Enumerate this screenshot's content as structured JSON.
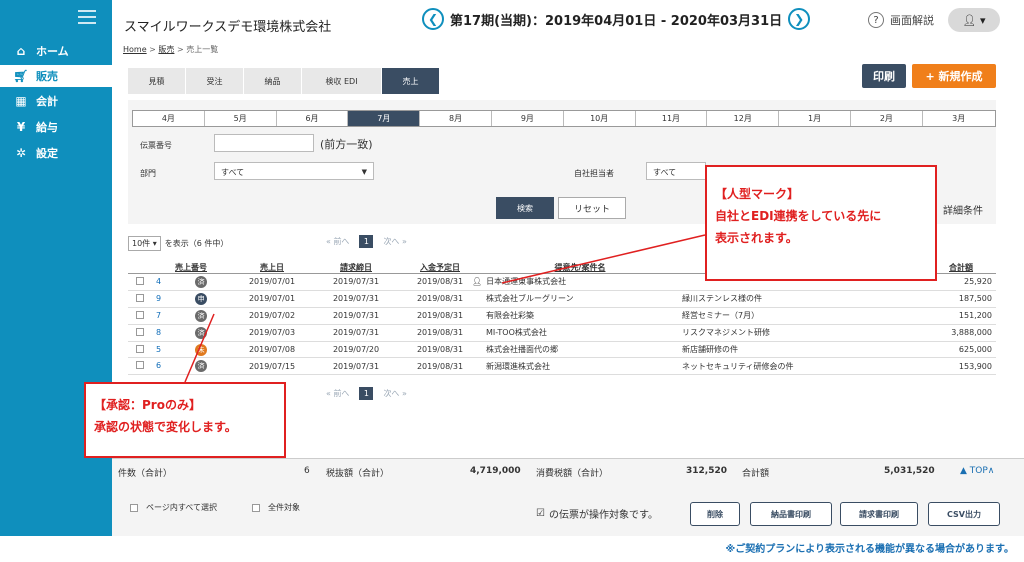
{
  "sidebar": {
    "items": [
      {
        "icon": "home-icon",
        "label": "ホーム"
      },
      {
        "icon": "cart-icon",
        "label": "販売"
      },
      {
        "icon": "calculator-icon",
        "label": "会計"
      },
      {
        "icon": "yen-bag-icon",
        "label": "給与"
      },
      {
        "icon": "gear-icon",
        "label": "設定"
      }
    ]
  },
  "header": {
    "company": "スマイルワークスデモ環境株式会社",
    "period": "第17期(当期)：2019年04月01日 - 2020年03月31日",
    "help": "画面解説"
  },
  "breadcrumb": {
    "home": "Home",
    "sales": "販売",
    "current": "売上一覧",
    "sep": ">"
  },
  "tabs": [
    "見積",
    "受注",
    "納品",
    "検収 EDI",
    "売上"
  ],
  "actions": {
    "print": "印刷",
    "new": "+ 新規作成"
  },
  "months": [
    "4月",
    "5月",
    "6月",
    "7月",
    "8月",
    "9月",
    "10月",
    "11月",
    "12月",
    "1月",
    "2月",
    "3月"
  ],
  "filters": {
    "slip_label": "伝票番号",
    "slip_hint": "(前方一致)",
    "dept_label": "部門",
    "dept_value": "すべて",
    "owner_label": "自社担当者",
    "owner_value": "すべて",
    "search": "検索",
    "reset": "リセット",
    "detail": "詳細条件"
  },
  "list": {
    "per_page": "10件",
    "showing": "を表示（6 件中）",
    "prev": "« 前へ",
    "page": "1",
    "next": "次へ »"
  },
  "columns": {
    "no": "売上番号",
    "date": "売上日",
    "bill": "請求締日",
    "due": "入金予定日",
    "customer": "得意先/案件名",
    "total": "合計額"
  },
  "rows": [
    {
      "no": "4",
      "status": "済",
      "color": "#6b6b6b",
      "date": "2019/07/01",
      "bill": "2019/07/31",
      "due": "2019/08/31",
      "customer": "日本通運東事株式会社",
      "project": "",
      "total": "25,920"
    },
    {
      "no": "9",
      "status": "申",
      "color": "#3a4d63",
      "date": "2019/07/01",
      "bill": "2019/07/31",
      "due": "2019/08/31",
      "customer": "株式会社ブルーグリーン",
      "project": "緑川ステンレス様の件",
      "total": "187,500"
    },
    {
      "no": "7",
      "status": "済",
      "color": "#6b6b6b",
      "date": "2019/07/02",
      "bill": "2019/07/31",
      "due": "2019/08/31",
      "customer": "有限会社彩築",
      "project": "経営セミナー（7月）",
      "total": "151,200"
    },
    {
      "no": "8",
      "status": "済",
      "color": "#6b6b6b",
      "date": "2019/07/03",
      "bill": "2019/07/31",
      "due": "2019/08/31",
      "customer": "MI-TOO株式会社",
      "project": "リスクマネジメント研修",
      "total": "3,888,000"
    },
    {
      "no": "5",
      "status": "未",
      "color": "#e07a1f",
      "date": "2019/07/08",
      "bill": "2019/07/20",
      "due": "2019/08/31",
      "customer": "株式会社播面代の郷",
      "project": "新店舗研修の件",
      "total": "625,000"
    },
    {
      "no": "6",
      "status": "済",
      "color": "#6b6b6b",
      "date": "2019/07/15",
      "bill": "2019/07/31",
      "due": "2019/08/31",
      "customer": "新潟環進株式会社",
      "project": "ネットセキュリティ研修会の件",
      "total": "153,900"
    }
  ],
  "totals": {
    "count_label": "件数（合計）",
    "count": "6",
    "tax_ex_label": "税抜額（合計）",
    "tax_ex": "4,719,000",
    "tax_label": "消費税額（合計）",
    "tax": "312,520",
    "sum_label": "合計額",
    "sum": "5,031,520",
    "top": "▲ TOP∧"
  },
  "footer": {
    "select_page": "ページ内すべて選択",
    "all": "全件対象",
    "target": "の伝票が操作対象です。",
    "delete": "削除",
    "delivery": "納品書印刷",
    "invoice": "請求書印刷",
    "csv": "CSV出力"
  },
  "callouts": {
    "person_title": "【人型マーク】",
    "person_line1": "自社とEDI連携をしている先に",
    "person_line2": "表示されます。",
    "approval_title": "【承認：Proのみ】",
    "approval_line1": "承認の状態で変化します。"
  },
  "note": "※ご契約プランにより表示される機能が異なる場合があります。"
}
